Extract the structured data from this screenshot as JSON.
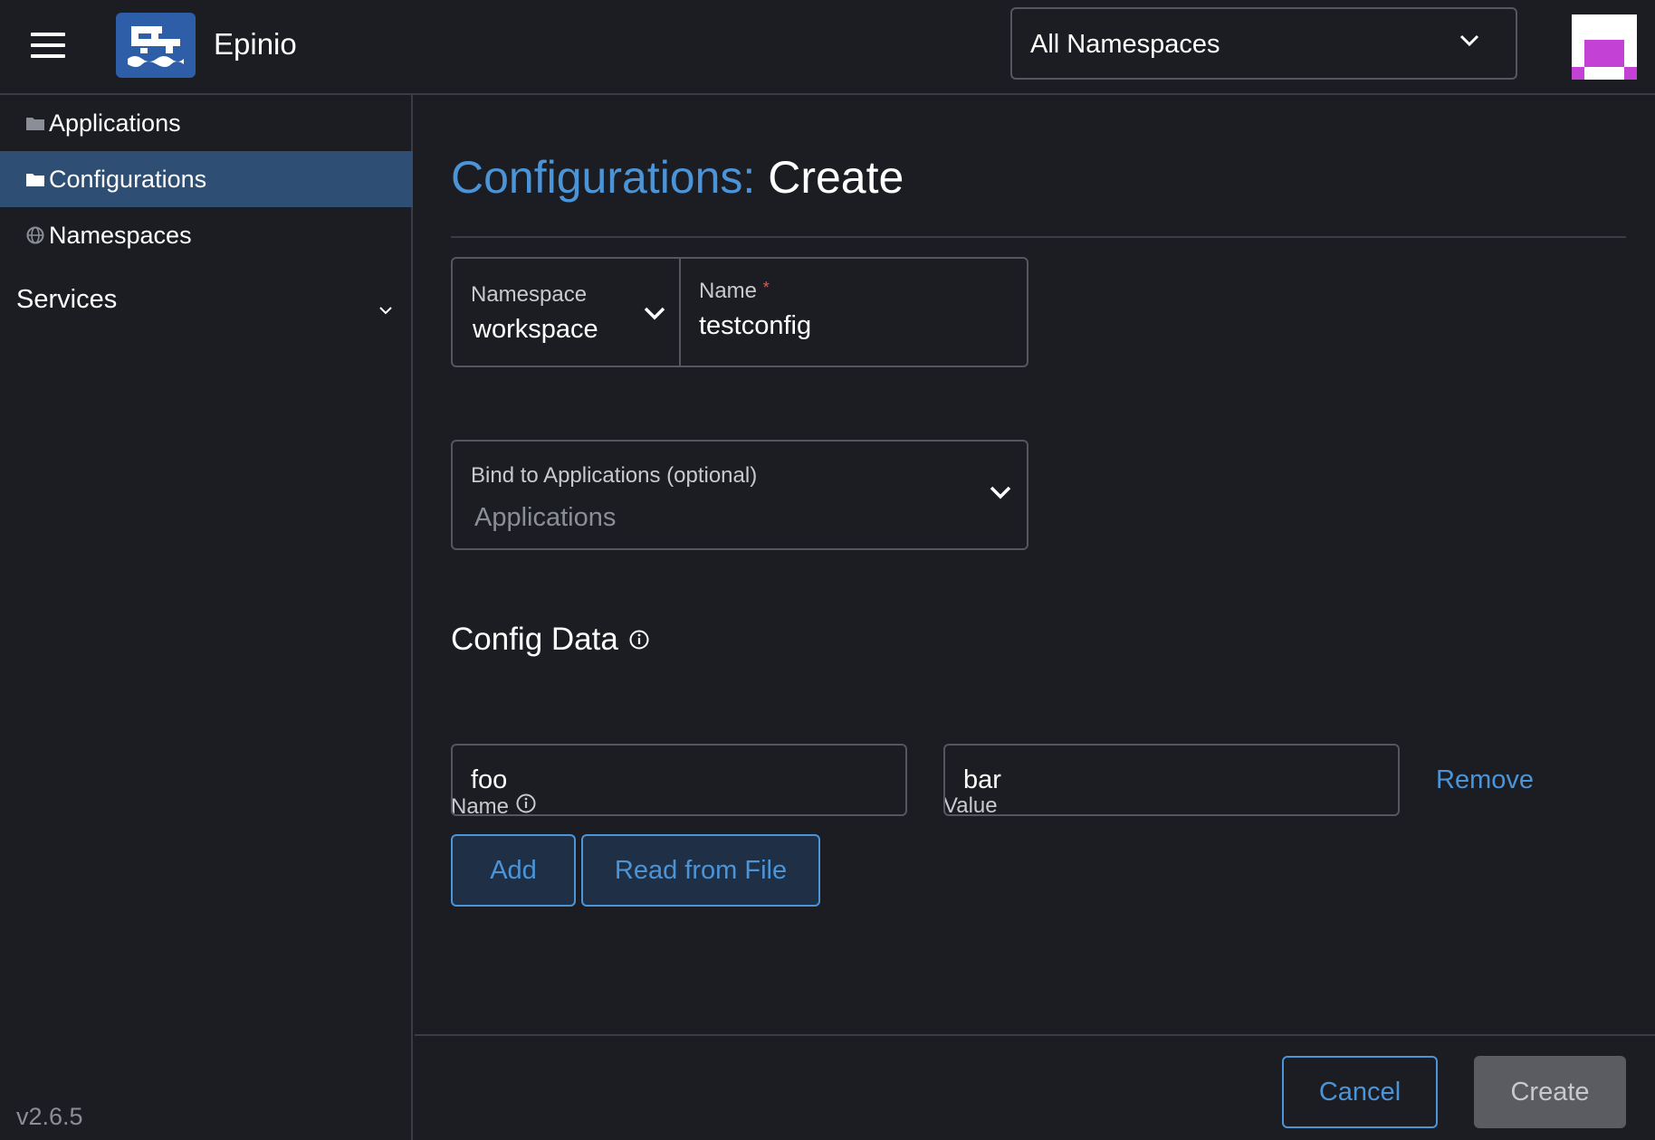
{
  "header": {
    "app_title": "Epinio",
    "namespace_filter": "All Namespaces",
    "menu_icon": "hamburger-icon",
    "logo_icon": "epinio-logo-icon"
  },
  "sidebar": {
    "items": [
      {
        "label": "Applications",
        "icon": "folder-icon",
        "active": false
      },
      {
        "label": "Configurations",
        "icon": "folder-icon",
        "active": true
      },
      {
        "label": "Namespaces",
        "icon": "globe-icon",
        "active": false
      }
    ],
    "services_label": "Services",
    "version": "v2.6.5"
  },
  "page": {
    "breadcrumb_parent": "Configurations",
    "breadcrumb_separator": ":",
    "title": "Create"
  },
  "form": {
    "namespace_label": "Namespace",
    "namespace_value": "workspace",
    "name_label": "Name",
    "name_required_mark": "*",
    "name_value": "testconfig",
    "bind_label": "Bind to Applications (optional)",
    "bind_placeholder": "Applications"
  },
  "config_data": {
    "section_title": "Config Data",
    "name_col_label": "Name",
    "value_col_label": "Value",
    "rows": [
      {
        "name": "foo",
        "value": "bar",
        "remove_label": "Remove"
      }
    ],
    "add_label": "Add",
    "read_file_label": "Read from File"
  },
  "footer": {
    "cancel_label": "Cancel",
    "create_label": "Create"
  },
  "colors": {
    "background": "#1b1d22",
    "accent": "#4c94d8",
    "active_nav": "#2e4f73",
    "required": "#e05a4f",
    "avatar_magenta": "#c441d6"
  }
}
